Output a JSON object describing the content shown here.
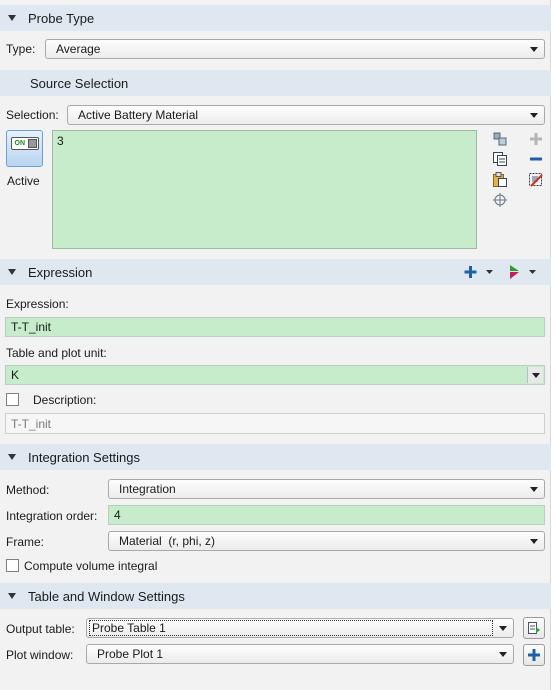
{
  "probe_type": {
    "header": "Probe Type",
    "type_label": "Type:",
    "type_value": "Average"
  },
  "source_selection": {
    "header": "Source Selection",
    "selection_label": "Selection:",
    "selection_value": "Active Battery Material",
    "toggle_text": "ON",
    "active_label": "Active",
    "list_items": [
      "3"
    ]
  },
  "expression": {
    "header": "Expression",
    "expression_label": "Expression:",
    "expression_value": "T-T_init",
    "unit_label": "Table and plot unit:",
    "unit_value": "K",
    "description_label": "Description:",
    "description_value": "T-T_init"
  },
  "integration": {
    "header": "Integration Settings",
    "method_label": "Method:",
    "method_value": "Integration",
    "order_label": "Integration order:",
    "order_value": "4",
    "frame_label": "Frame:",
    "frame_value": "Material  (r, phi, z)",
    "volume_label": "Compute volume integral"
  },
  "table_window": {
    "header": "Table and Window Settings",
    "output_label": "Output table:",
    "output_value": "Probe Table 1",
    "plot_label": "Plot window:",
    "plot_value": "Probe Plot 1"
  },
  "colors": {
    "header_bg": "#dfe8f1",
    "field_green": "#c6eccb",
    "plus_blue": "#1f5fa8"
  }
}
